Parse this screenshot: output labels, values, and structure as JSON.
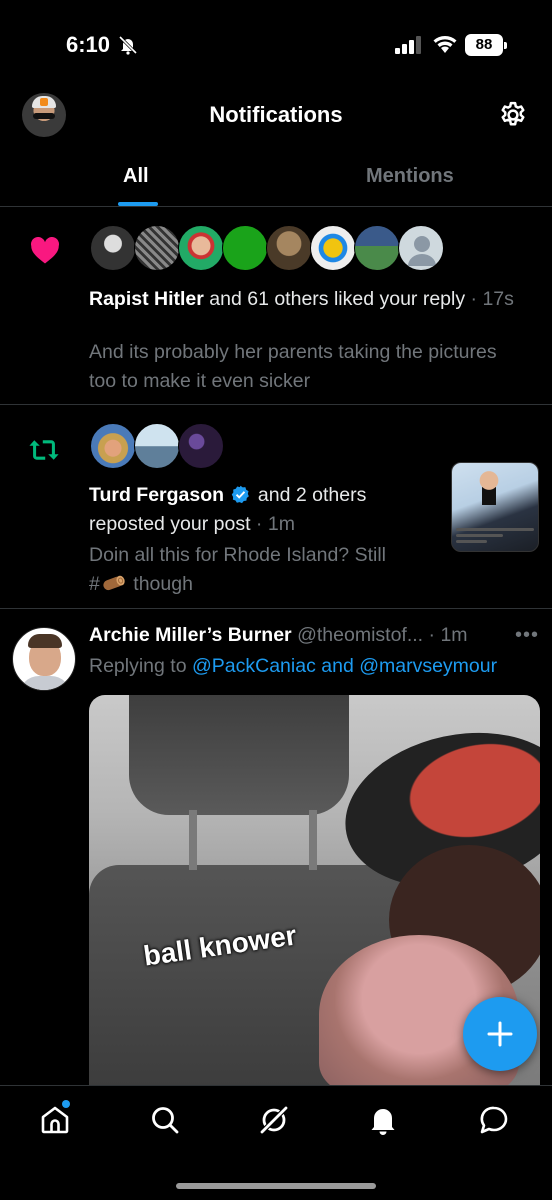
{
  "status_bar": {
    "time": "6:10",
    "battery": "88"
  },
  "header": {
    "title": "Notifications"
  },
  "tabs": [
    {
      "label": "All",
      "active": true
    },
    {
      "label": "Mentions",
      "active": false
    }
  ],
  "notifications": [
    {
      "type": "like",
      "icon": "heart-icon",
      "actor": "Rapist Hitler",
      "action": " and 61 others liked your reply",
      "time": "17s",
      "body": "And its probably her parents taking the pictures too to make it even sicker"
    },
    {
      "type": "repost",
      "icon": "repost-icon",
      "actor": "Turd Fergason",
      "action_line1": "and 2 others",
      "action_line2": "reposted your post",
      "time": "1m",
      "body_line1": "Doin all this for Rhode Island? Still",
      "body_prefix": "#",
      "body_suffix": " though"
    }
  ],
  "post": {
    "author": "Archie Miller’s Burner",
    "handle": "@theomistof...",
    "time": "1m",
    "replying_prefix": "Replying to ",
    "replying_to": "@PackCaniac and @marvseymour",
    "media_caption": "ball knower"
  },
  "colors": {
    "accent": "#1d9bf0",
    "like": "#f91880",
    "repost": "#00ba7c",
    "muted": "#71767b"
  }
}
